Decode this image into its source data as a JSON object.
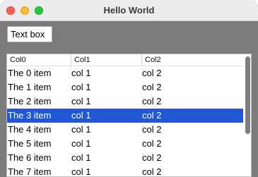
{
  "window": {
    "title": "Hello World"
  },
  "textbox": {
    "value": "Text box"
  },
  "listview": {
    "columns": [
      "Col0",
      "Col1",
      "Col2"
    ],
    "rows": [
      [
        "The 0 item",
        "col 1",
        "col 2"
      ],
      [
        "The 1 item",
        "col 1",
        "col 2"
      ],
      [
        "The 2 item",
        "col 1",
        "col 2"
      ],
      [
        "The 3 item",
        "col 1",
        "col 2"
      ],
      [
        "The 4 item",
        "col 1",
        "col 2"
      ],
      [
        "The 5 item",
        "col 1",
        "col 2"
      ],
      [
        "The 6 item",
        "col 1",
        "col 2"
      ],
      [
        "The 7 item",
        "col 1",
        "col 2"
      ]
    ],
    "selected_row": 3
  },
  "colors": {
    "selection": "#2156d6",
    "window_bg": "#7b7b7b"
  }
}
